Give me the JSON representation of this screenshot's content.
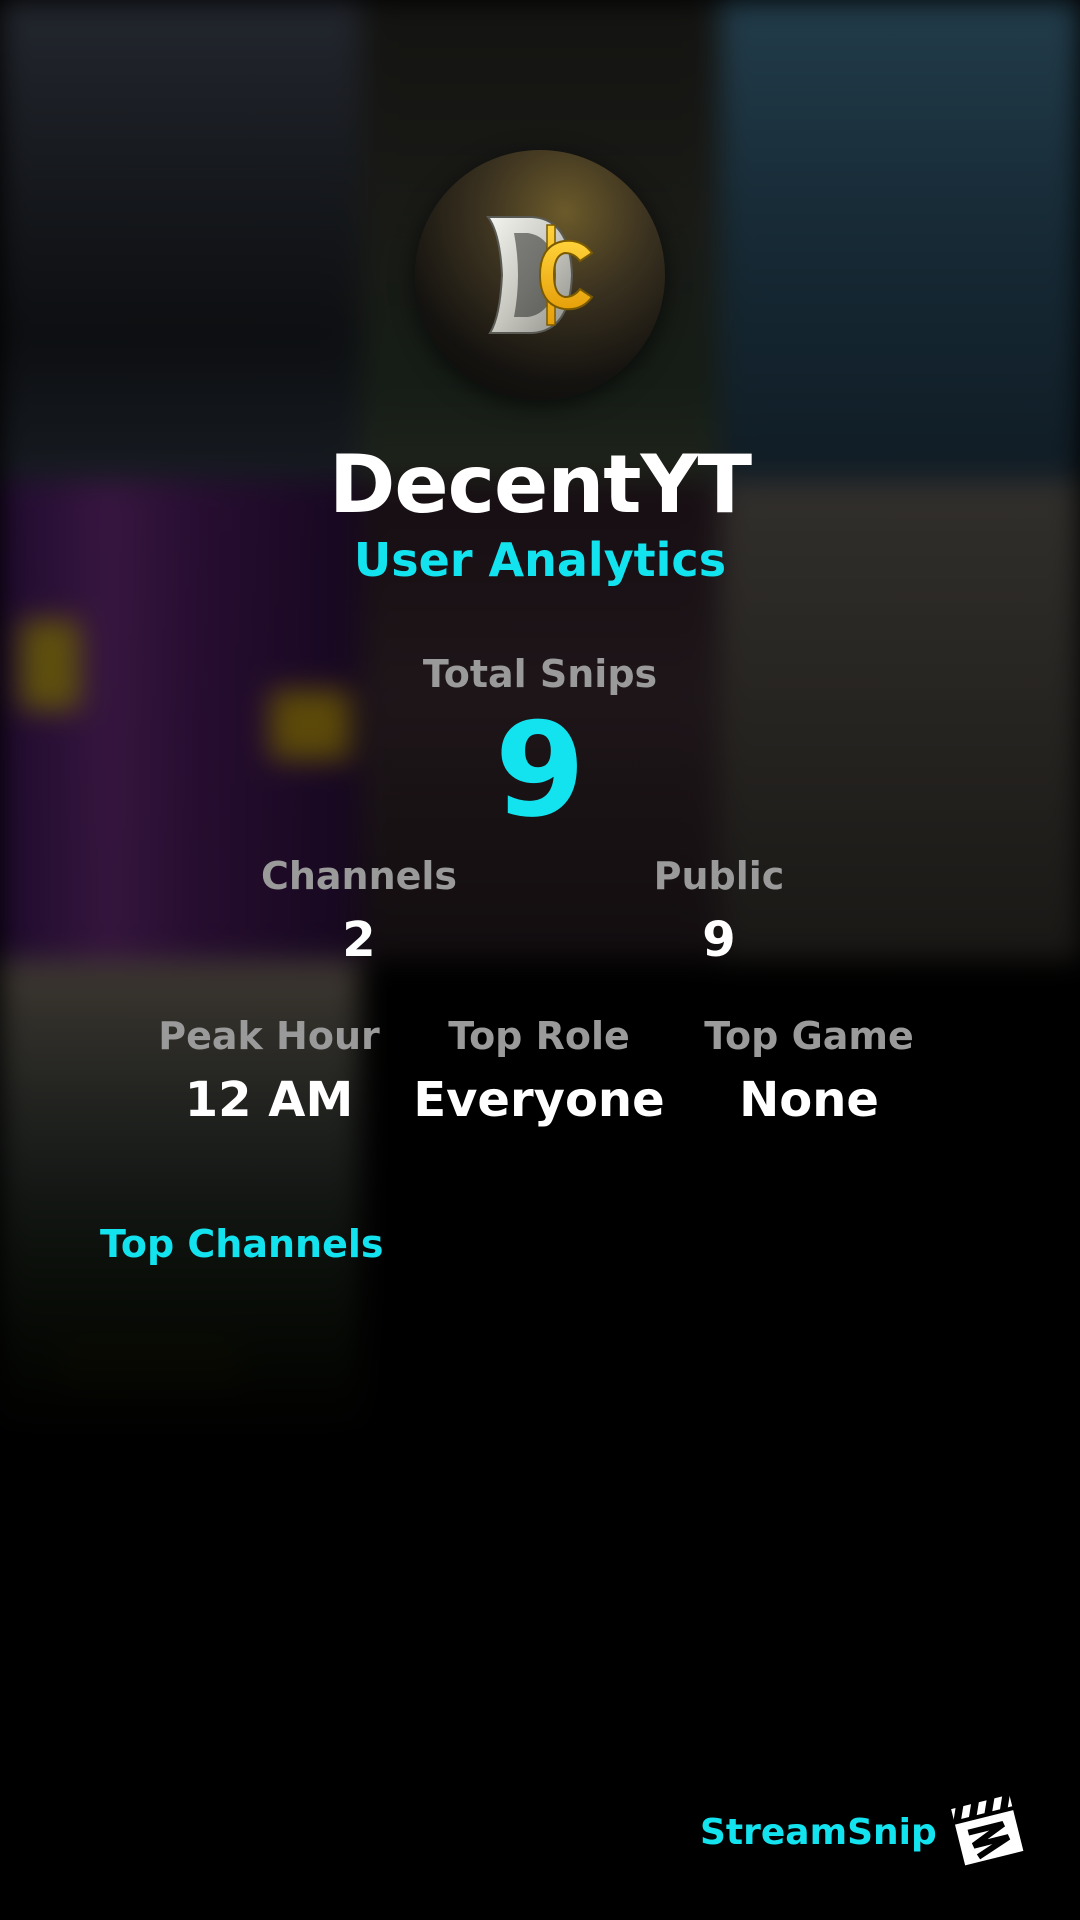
{
  "profile": {
    "name": "DecentYT",
    "subtitle": "User Analytics",
    "avatar_icon": "decent-coin-logo-icon"
  },
  "stats": {
    "total_snips_label": "Total Snips",
    "total_snips_value": "9",
    "channels_label": "Channels",
    "channels_value": "2",
    "public_label": "Public",
    "public_value": "9",
    "peak_hour_label": "Peak Hour",
    "peak_hour_value": "12 AM",
    "top_role_label": "Top Role",
    "top_role_value": "Everyone",
    "top_game_label": "Top Game",
    "top_game_value": "None"
  },
  "sections": {
    "top_channels_title": "Top Channels"
  },
  "footer": {
    "brand_name": "StreamSnip",
    "brand_icon": "clapperboard-icon"
  },
  "colors": {
    "accent": "#13e3ef",
    "label_gray": "#9a9a9a",
    "text_white": "#ffffff",
    "background": "#000000"
  }
}
